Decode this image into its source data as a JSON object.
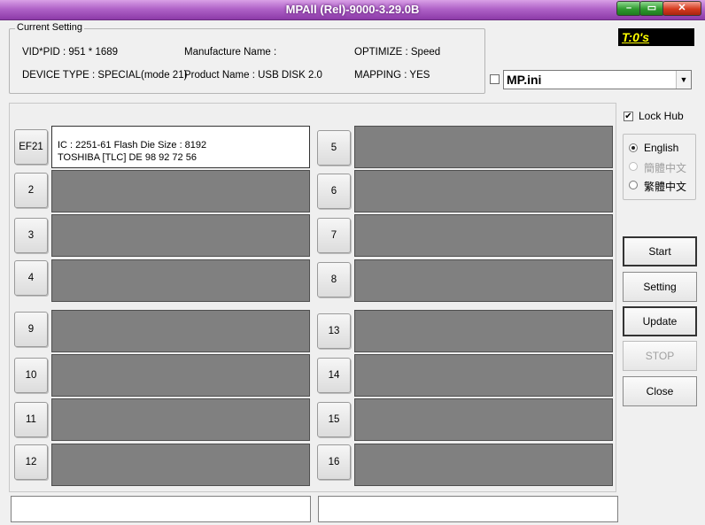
{
  "window": {
    "title": "MPAll (Rel)-9000-3.29.0B",
    "min": "–",
    "max": "▭",
    "close": "✕"
  },
  "current_setting": {
    "legend": "Current Setting",
    "vid_pid": "VID*PID :  951 * 1689",
    "manufacture_name": "Manufacture Name :",
    "optimize": "OPTIMIZE : Speed",
    "device_type": "DEVICE TYPE : SPECIAL(mode 21)",
    "product_name": "Product Name : USB DISK 2.0",
    "mapping": "MAPPING : YES"
  },
  "timer": "T:0's",
  "config": {
    "checked": false,
    "selected": "MP.ini",
    "arrow": "▼"
  },
  "ports": [
    {
      "label": "EF21",
      "line1": "IC : 2251-61  Flash Die Size : 8192",
      "line2": "TOSHIBA [TLC] DE 98 92 72 56",
      "active": true
    },
    {
      "label": "2"
    },
    {
      "label": "3"
    },
    {
      "label": "4"
    },
    {
      "label": "5"
    },
    {
      "label": "6"
    },
    {
      "label": "7"
    },
    {
      "label": "8"
    },
    {
      "label": "9"
    },
    {
      "label": "10"
    },
    {
      "label": "11"
    },
    {
      "label": "12"
    },
    {
      "label": "13"
    },
    {
      "label": "14"
    },
    {
      "label": "15"
    },
    {
      "label": "16"
    }
  ],
  "lock_hub": {
    "label": "Lock Hub",
    "checked": true,
    "mark": "✔"
  },
  "languages": [
    {
      "label": "English",
      "selected": true,
      "enabled": true
    },
    {
      "label": "簡體中文",
      "selected": false,
      "enabled": false
    },
    {
      "label": "繁體中文",
      "selected": false,
      "enabled": true
    }
  ],
  "actions": {
    "start": "Start",
    "setting": "Setting",
    "update": "Update",
    "stop": "STOP",
    "close": "Close"
  },
  "colors": {
    "title_bar": "#a34fbf",
    "empty_port": "#808080",
    "timer_text": "#ffff00"
  }
}
